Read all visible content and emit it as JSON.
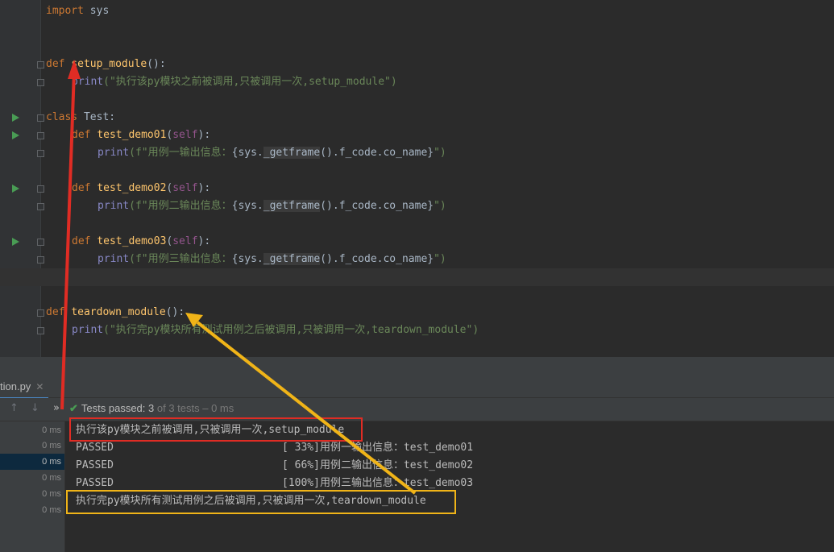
{
  "editor": {
    "import_kw": "import",
    "import_mod": " sys",
    "setup_def_kw": "def",
    "setup_name": "setup_module",
    "setup_params": "():",
    "setup_print_fn": "print",
    "setup_print_str": "(\"执行该py模块之前被调用,只被调用一次,setup_module\")",
    "class_kw": "class",
    "class_name": " Test:",
    "demo1_kw": "def",
    "demo1_name": "test_demo01",
    "demo1_open": "(",
    "demo1_self": "self",
    "demo1_close": "):",
    "demo1_print": "print",
    "demo1_str_a": "(f\"用例一输出信息：",
    "demo1_expr_a": "{sys.",
    "demo1_getframe": "_getframe",
    "demo1_expr_b": "().f_code.co_name}",
    "demo1_str_b": "\")",
    "demo2_kw": "def",
    "demo2_name": "test_demo02",
    "demo2_open": "(",
    "demo2_self": "self",
    "demo2_close": "):",
    "demo2_print": "print",
    "demo2_str_a": "(f\"用例二输出信息：",
    "demo2_expr_a": "{sys.",
    "demo2_getframe": "_getframe",
    "demo2_expr_b": "().f_code.co_name}",
    "demo2_str_b": "\")",
    "demo3_kw": "def",
    "demo3_name": "test_demo03",
    "demo3_open": "(",
    "demo3_self": "self",
    "demo3_close": "):",
    "demo3_print": "print",
    "demo3_str_a": "(f\"用例三输出信息：",
    "demo3_expr_a": "{sys.",
    "demo3_getframe": "_getframe",
    "demo3_expr_b": "().f_code.co_name}",
    "demo3_str_b": "\")",
    "teardown_def_kw": "def",
    "teardown_name": "teardown_module",
    "teardown_params": "():",
    "teardown_print_fn": "print",
    "teardown_print_str": "(\"执行完py模块所有测试用例之后被调用,只被调用一次,teardown_module\")"
  },
  "run_panel": {
    "tab_label": "tion.py",
    "close_glyph": "✕",
    "up_glyph": "↑",
    "down_glyph": "↓",
    "more_glyph": "»",
    "check_glyph": "✔",
    "status_prefix": "Tests passed:",
    "status_count": "3",
    "status_suffix": "of 3 tests – 0 ms",
    "tree_times": [
      "0 ms",
      "0 ms",
      "0 ms",
      "0 ms",
      "0 ms",
      "0 ms"
    ]
  },
  "console": {
    "setup_line": "执行该py模块之前被调用,只被调用一次,setup_module",
    "rows": [
      {
        "status": "PASSED",
        "progress": "[ 33%]",
        "message": "用例一输出信息：test_demo01"
      },
      {
        "status": "PASSED",
        "progress": "[ 66%]",
        "message": "用例二输出信息：test_demo02"
      },
      {
        "status": "PASSED",
        "progress": "[100%]",
        "message": "用例三输出信息：test_demo03"
      }
    ],
    "teardown_line": "执行完py模块所有测试用例之后被调用,只被调用一次,teardown_module"
  },
  "colors": {
    "red_annotation": "#e02c24",
    "yellow_annotation": "#f0b418",
    "run_icon": "#499c54"
  }
}
